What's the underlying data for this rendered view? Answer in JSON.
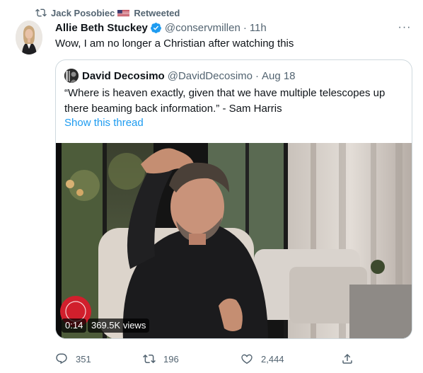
{
  "retweet": {
    "user": "Jack Posobiec",
    "label": "Retweeted"
  },
  "tweet": {
    "author_name": "Allie Beth Stuckey",
    "handle": "@conservmillen",
    "separator": "·",
    "time": "11h",
    "text": "Wow, I am no longer a Christian after watching this",
    "more_label": "···"
  },
  "quoted": {
    "author_name": "David Decosimo",
    "handle": "@DavidDecosimo",
    "separator": "·",
    "date": "Aug 18",
    "text": "“Where is heaven exactly, given that we have multiple telescopes up there beaming back information.” - Sam Harris",
    "show_thread": "Show this thread",
    "video": {
      "duration": "0:14",
      "views": "369.5K views"
    }
  },
  "actions": {
    "replies": "351",
    "retweets": "196",
    "likes": "2,444"
  },
  "colors": {
    "link": "#1d9bf0",
    "secondary_text": "#536471",
    "border": "#cfd9de",
    "verified": "#1d9bf0"
  }
}
